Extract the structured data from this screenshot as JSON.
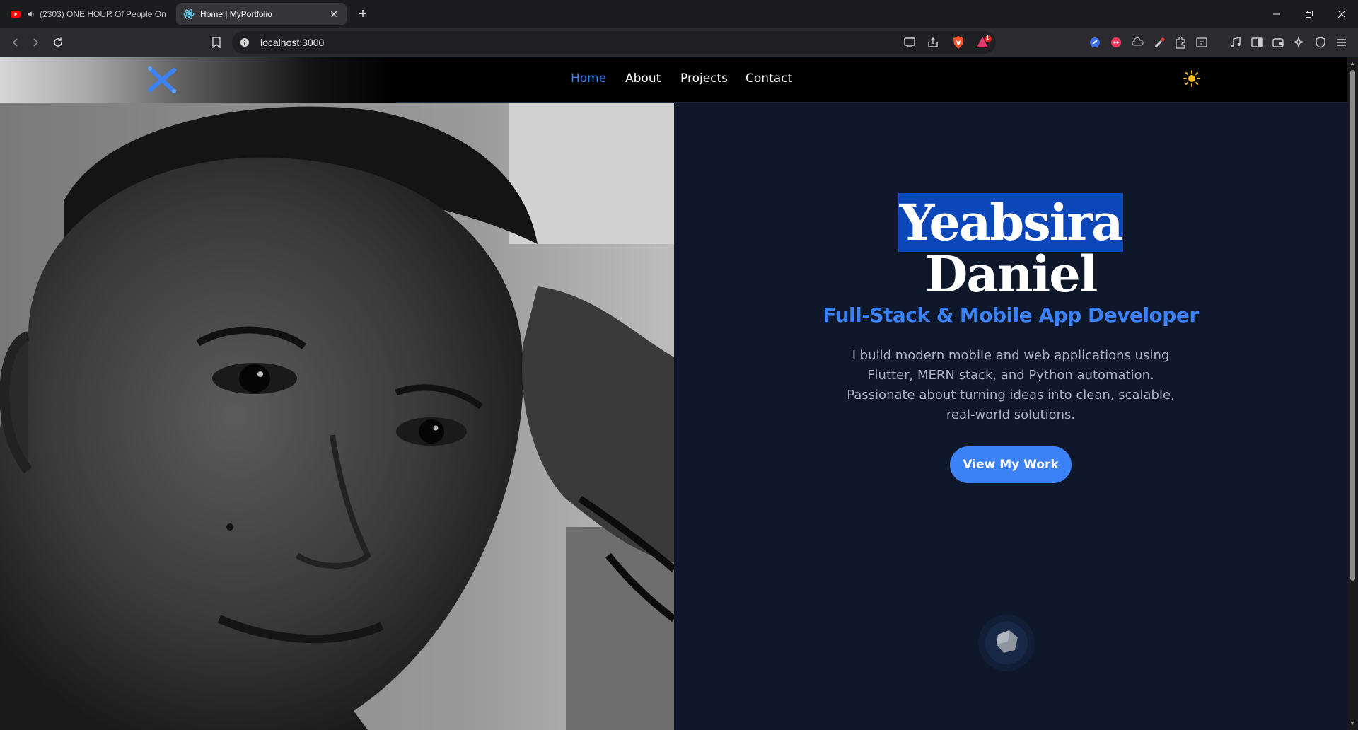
{
  "browser": {
    "tabs": [
      {
        "title": "(2303) ONE HOUR Of People On",
        "favicon": "youtube-icon",
        "audio": true,
        "active": false
      },
      {
        "title": "Home | MyPortfolio",
        "favicon": "react-icon",
        "active": true
      }
    ],
    "address": "localhost:3000",
    "shields_badge": "1"
  },
  "site": {
    "nav": {
      "items": [
        "Home",
        "About",
        "Projects",
        "Contact"
      ],
      "active": "Home"
    },
    "hero": {
      "first_name": "Yeabsira",
      "last_name": "Daniel",
      "subtitle": "Full-Stack & Mobile App Developer",
      "description": "I build modern mobile and web applications using Flutter, MERN stack, and Python automation. Passionate about turning ideas into clean, scalable, real-world solutions.",
      "cta": "View My Work"
    },
    "colors": {
      "accent": "#3b82f6",
      "background": "#0f172a",
      "nav_bg": "#000000",
      "name_highlight": "#0b47b8"
    }
  }
}
